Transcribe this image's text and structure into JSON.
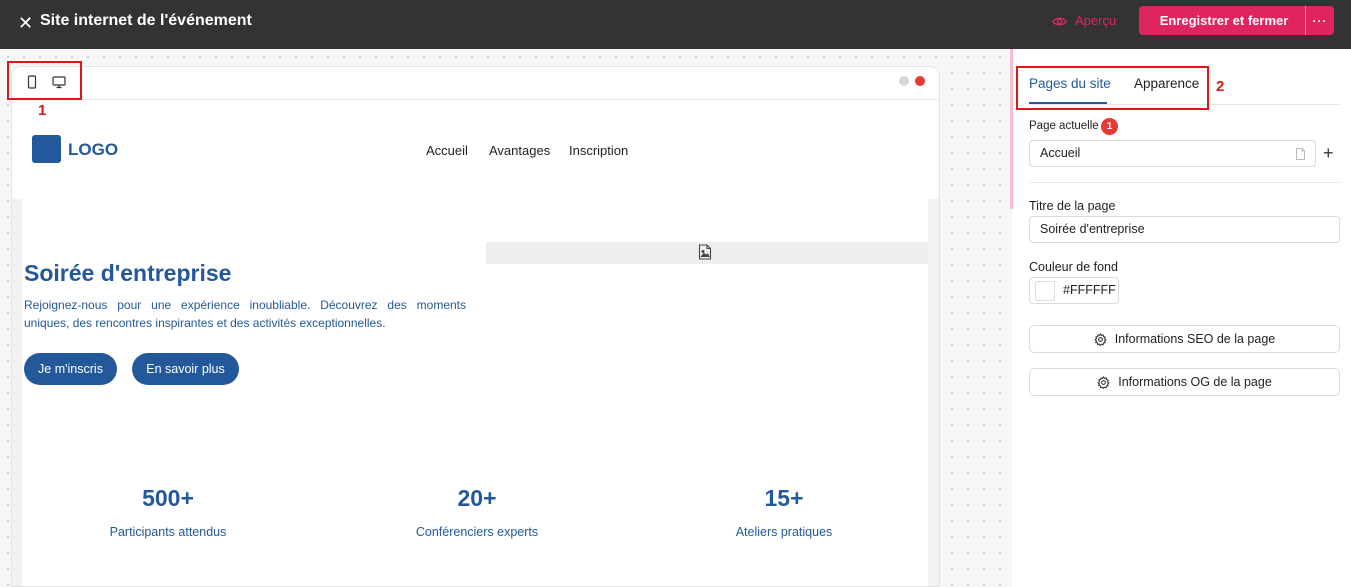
{
  "header": {
    "title": "Site internet de l'événement",
    "preview_label": "Aperçu",
    "save_label": "Enregistrer et fermer",
    "more_label": "···"
  },
  "preview_site": {
    "logo_text": "LOGO",
    "nav": [
      "Accueil",
      "Avantages",
      "Inscription"
    ],
    "hero_title": "Soirée d'entreprise",
    "hero_description": "Rejoignez-nous pour une expérience inoubliable. Découvrez des moments uniques, des rencontres inspirantes et des activités exceptionnelles.",
    "primary_button": "Je m'inscris",
    "secondary_button": "En savoir plus",
    "stats": [
      {
        "number": "500+",
        "label": "Participants attendus"
      },
      {
        "number": "20+",
        "label": "Conférenciers experts"
      },
      {
        "number": "15+",
        "label": "Ateliers pratiques"
      }
    ]
  },
  "annotations": {
    "device_toggle_number": "1",
    "tabs_number": "2"
  },
  "panel": {
    "tabs": [
      "Pages du site",
      "Apparence"
    ],
    "active_tab": "Pages du site",
    "current_page_label": "Page actuelle",
    "current_page_badge": "1",
    "current_page_value": "Accueil",
    "page_title_label": "Titre de la page",
    "page_title_value": "Soirée d'entreprise",
    "bg_color_label": "Couleur de fond",
    "bg_color_value": "#FFFFFF",
    "seo_button": "Informations SEO de la page",
    "og_button": "Informations OG de la page"
  },
  "colors": {
    "accent": "#e0245e",
    "brand_blue": "#23599a",
    "topbar": "#333333"
  },
  "icons": [
    "close-icon",
    "eye-icon",
    "mobile-icon",
    "desktop-icon",
    "image-placeholder-icon",
    "page-icon",
    "plus-icon",
    "gear-icon"
  ]
}
